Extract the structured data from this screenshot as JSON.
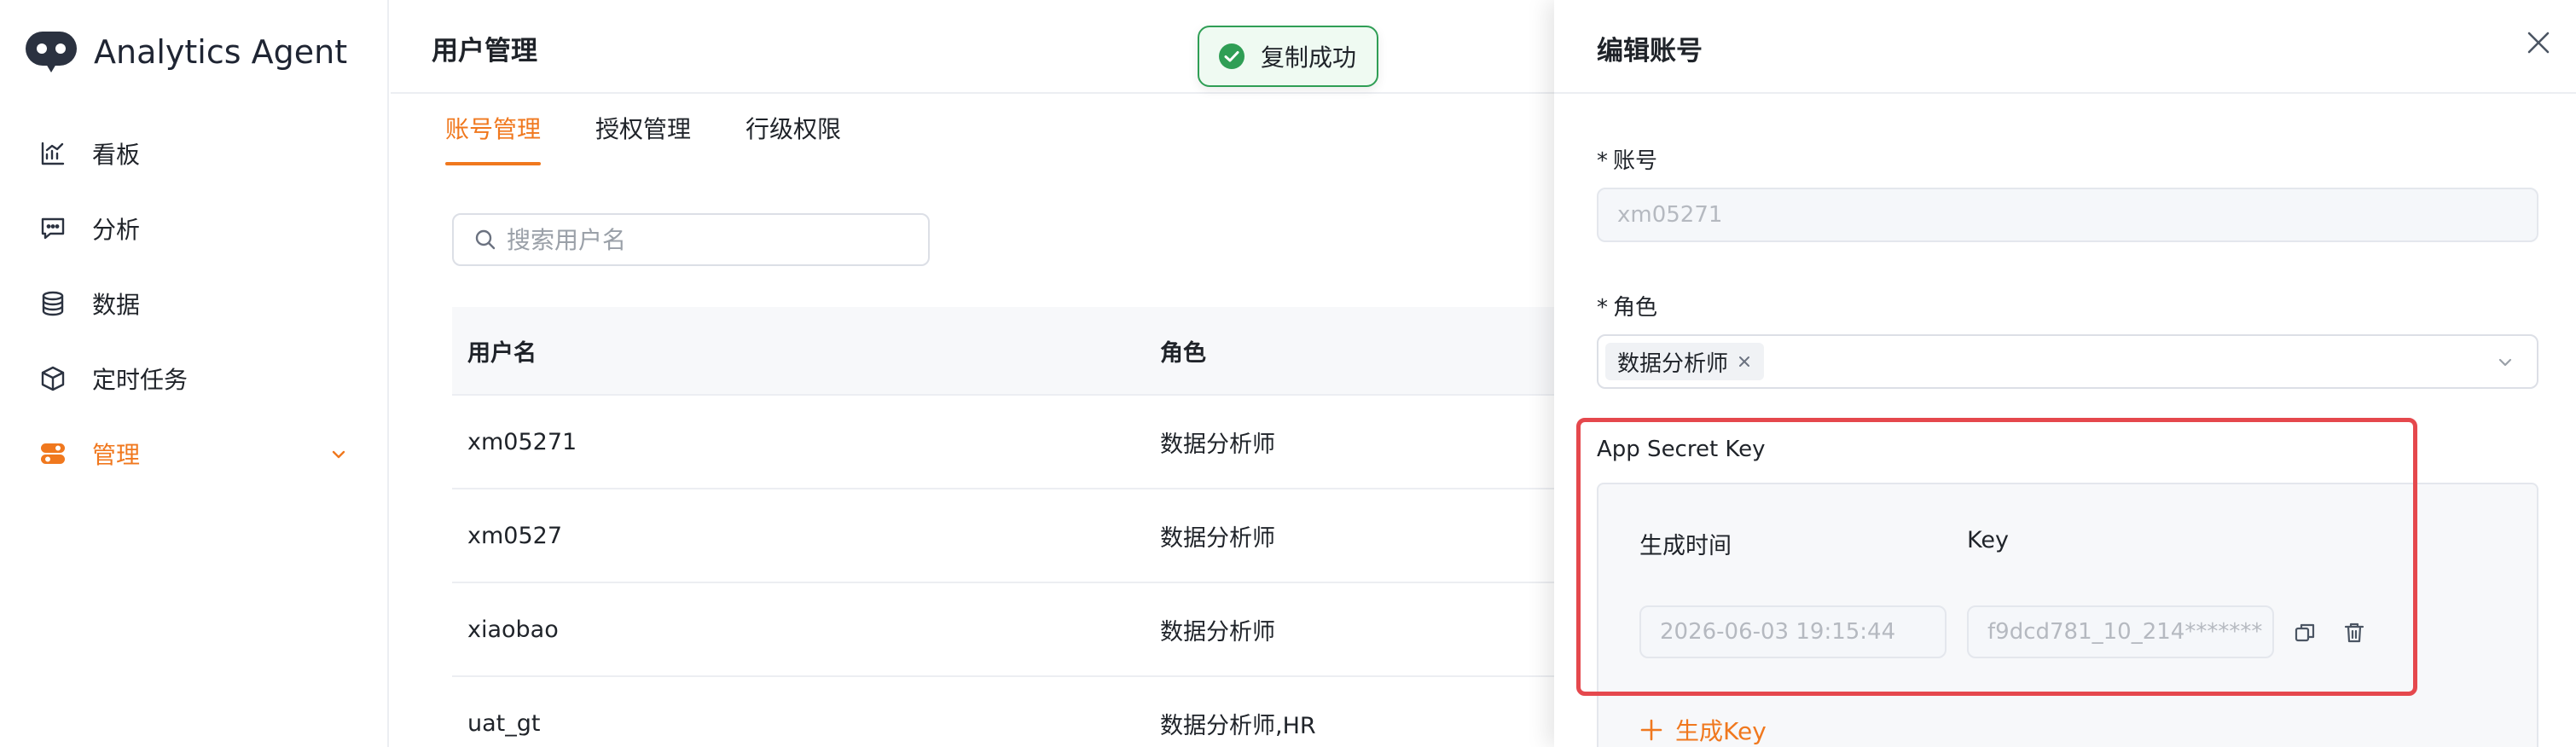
{
  "app": {
    "name": "Analytics Agent"
  },
  "sidebar": {
    "items": [
      {
        "label": "看板",
        "icon": "chart-icon"
      },
      {
        "label": "分析",
        "icon": "message-icon"
      },
      {
        "label": "数据",
        "icon": "database-icon"
      },
      {
        "label": "定时任务",
        "icon": "cube-icon"
      },
      {
        "label": "管理",
        "icon": "toggle-icon",
        "active": true,
        "expanded": true
      }
    ]
  },
  "main": {
    "title": "用户管理",
    "tabs": [
      {
        "label": "账号管理",
        "active": true
      },
      {
        "label": "授权管理"
      },
      {
        "label": "行级权限"
      }
    ],
    "search": {
      "placeholder": "搜索用户名",
      "value": ""
    },
    "table": {
      "columns": [
        "用户名",
        "角色"
      ],
      "rows": [
        [
          "xm05271",
          "数据分析师"
        ],
        [
          "xm0527",
          "数据分析师"
        ],
        [
          "xiaobao",
          "数据分析师"
        ],
        [
          "uat_gt",
          "数据分析师,HR"
        ]
      ]
    }
  },
  "toast": {
    "text": "复制成功",
    "type": "success"
  },
  "drawer": {
    "title": "编辑账号",
    "account": {
      "label": "账号",
      "required": true,
      "value": "xm05271"
    },
    "role": {
      "label": "角色",
      "required": true,
      "tags": [
        "数据分析师"
      ]
    },
    "secret": {
      "label": "App Secret Key",
      "time_header": "生成时间",
      "key_header": "Key",
      "time_value": "2026-06-03 19:15:44",
      "key_value": "f9dcd781_10_214*******",
      "generate_label": "生成Key"
    }
  },
  "colors": {
    "accent": "#f0781e",
    "success": "#2f9e55",
    "highlight": "#e5484d"
  }
}
